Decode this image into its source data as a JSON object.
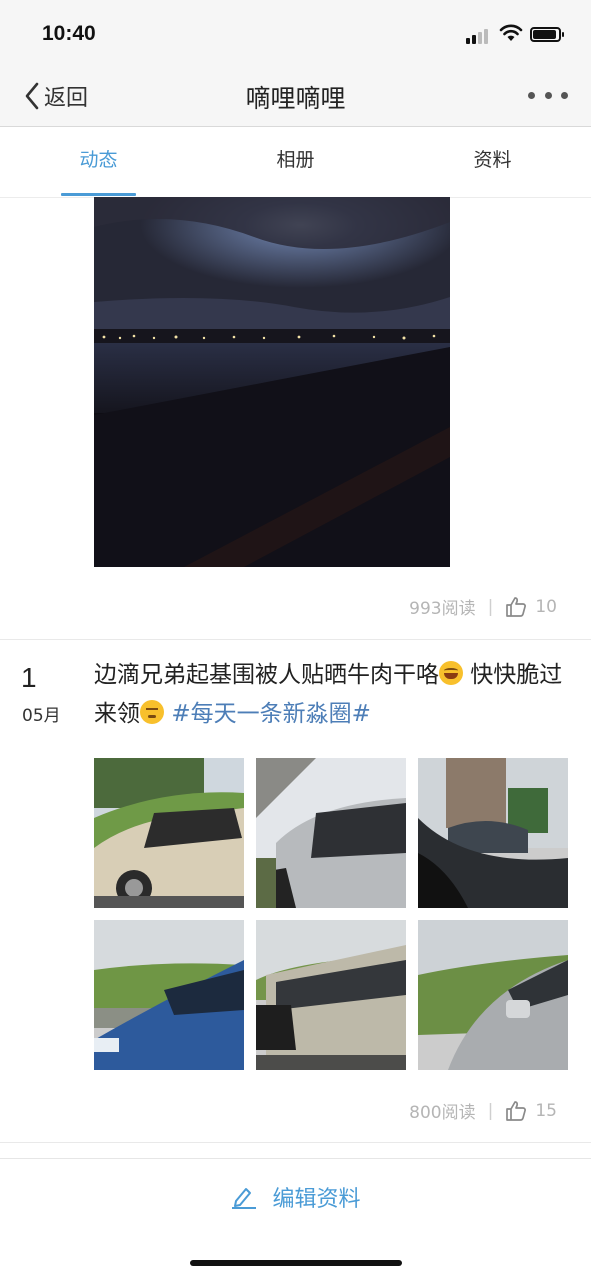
{
  "status_bar": {
    "time": "10:40"
  },
  "nav": {
    "back_label": "返回",
    "title": "嘀哩嘀哩"
  },
  "tabs": [
    {
      "label": "动态",
      "active": true
    },
    {
      "label": "相册",
      "active": false
    },
    {
      "label": "资料",
      "active": false
    }
  ],
  "posts": [
    {
      "reads": "993阅读",
      "separator": "|",
      "likes": "10"
    },
    {
      "date_day": "1",
      "date_month": "05月",
      "text_part1": "边滴兄弟起基围被人贴晒牛肉干咯",
      "text_part2": " 快快脆过来领",
      "hashtag": "#每天一条新淼圈#",
      "reads": "800阅读",
      "separator": "|",
      "likes": "15"
    }
  ],
  "bottom": {
    "edit_label": "编辑资料"
  },
  "colors": {
    "accent": "#4a9bd6",
    "hashtag": "#4d7eb7",
    "muted": "#b5b5b5"
  },
  "icons": [
    "chevron-left-icon",
    "more-icon",
    "thumbs-up-icon",
    "edit-pencil-icon",
    "wifi-icon",
    "battery-icon",
    "signal-icon"
  ]
}
